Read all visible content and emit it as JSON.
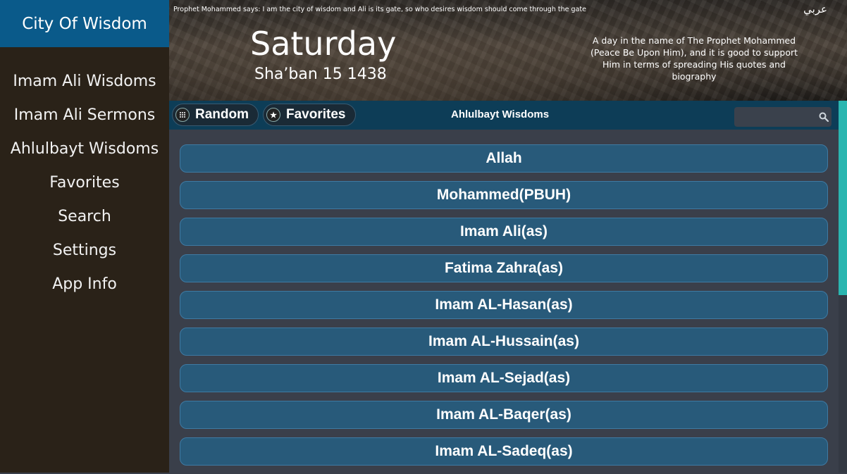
{
  "sidebar": {
    "brand": "City Of Wisdom",
    "items": [
      {
        "label": "Imam Ali Wisdoms"
      },
      {
        "label": "Imam Ali Sermons"
      },
      {
        "label": "Ahlulbayt Wisdoms"
      },
      {
        "label": "Favorites"
      },
      {
        "label": "Search"
      },
      {
        "label": "Settings"
      },
      {
        "label": "App Info"
      }
    ]
  },
  "header": {
    "quote": "Prophet Mohammed says: I am the city of wisdom and Ali is its gate, so who desires wisdom should come through the gate",
    "language_link": "عربي",
    "day": "Saturday",
    "date": "Sha’ban 15 1438",
    "description": "A day in the name of The Prophet Mohammed (Peace Be Upon Him), and it is good to support Him in terms of spreading His quotes and biography"
  },
  "toolbar": {
    "random_label": "Random",
    "favorites_label": "Favorites",
    "title": "Ahlulbayt Wisdoms",
    "search_value": ""
  },
  "list": {
    "items": [
      {
        "label": "Allah"
      },
      {
        "label": "Mohammed(PBUH)"
      },
      {
        "label": "Imam Ali(as)"
      },
      {
        "label": "Fatima Zahra(as)"
      },
      {
        "label": "Imam AL-Hasan(as)"
      },
      {
        "label": "Imam AL-Hussain(as)"
      },
      {
        "label": "Imam AL-Sejad(as)"
      },
      {
        "label": "Imam AL-Baqer(as)"
      },
      {
        "label": "Imam AL-Sadeq(as)"
      }
    ]
  },
  "icons": {
    "random": "grid-dots-icon",
    "favorites": "star-icon",
    "search": "search-icon"
  },
  "colors": {
    "brand": "#0a5a8a",
    "sidebar": "#2a2218",
    "toolbar": "#0d3d57",
    "list_item": "#285a7a",
    "scroll_thumb": "#2ab6b0"
  }
}
